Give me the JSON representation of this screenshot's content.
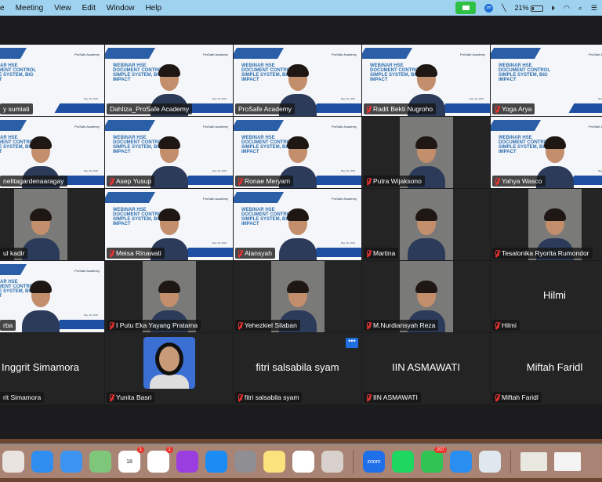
{
  "menubar": {
    "items": [
      "e",
      "Meeting",
      "View",
      "Edit",
      "Window",
      "Help"
    ],
    "battery": "21%",
    "battery_level": 0.21
  },
  "slide": {
    "brand": "ProSafe Academy",
    "title": "WEBINAR HSE DOCUMENT CONTROL SIMPLE SYSTEM, BIG IMPACT",
    "date": "May 18, 2025"
  },
  "tiles": [
    {
      "name": "y sumiati",
      "type": "slide",
      "muted": false
    },
    {
      "name": "Dahliza_ProSafe Academy",
      "type": "slide-person",
      "muted": false,
      "active": true
    },
    {
      "name": "ProSafe Academy",
      "type": "slide-person",
      "muted": false
    },
    {
      "name": "Radit Bekti Nugroho",
      "type": "slide-person",
      "muted": true
    },
    {
      "name": "Yoga Arya",
      "type": "slide",
      "muted": true
    },
    {
      "name": "nelitagardenaaragay",
      "type": "slide-person",
      "muted": false
    },
    {
      "name": "Asep Yusup",
      "type": "slide-person",
      "muted": true
    },
    {
      "name": "Ronae Meryam",
      "type": "slide-person",
      "muted": true
    },
    {
      "name": "Putra Wijaksono",
      "type": "narrow",
      "muted": true
    },
    {
      "name": "Yahya Wasco",
      "type": "slide-person",
      "muted": true
    },
    {
      "name": "ul kadir",
      "type": "narrow",
      "muted": false
    },
    {
      "name": "Meisa Rinawati",
      "type": "slide-person",
      "muted": true
    },
    {
      "name": "Alansyah",
      "type": "slide-person",
      "muted": true
    },
    {
      "name": "Martina",
      "type": "narrow",
      "muted": true
    },
    {
      "name": "Tesalonika Ryorita Rumondor",
      "type": "narrow",
      "muted": true
    },
    {
      "name": "rba",
      "type": "slide-person",
      "muted": false
    },
    {
      "name": "I Putu Eka Yayang Pratama",
      "type": "narrow",
      "muted": true
    },
    {
      "name": "Yehezkiel Silaban",
      "type": "narrow",
      "muted": true
    },
    {
      "name": "M.Nurdiansyah Reza",
      "type": "narrow",
      "muted": true
    },
    {
      "name": "Hilmi",
      "type": "noVideo",
      "display": "Hilmi",
      "muted": true
    },
    {
      "name": "rit Simamora",
      "type": "noVideo",
      "display": "Inggrit Simamora",
      "muted": false
    },
    {
      "name": "Yunita Basri",
      "type": "avatar",
      "muted": true
    },
    {
      "name": "fitri salsabila syam",
      "type": "noVideo",
      "display": "fitri salsabila syam",
      "muted": true
    },
    {
      "name": "IIN ASMAWATI",
      "type": "noVideo",
      "display": "IIN ASMAWATI",
      "muted": true
    },
    {
      "name": "Miftah Faridl",
      "type": "noVideo",
      "display": "Miftah Faridl",
      "muted": true
    }
  ],
  "more_button": "•••",
  "dock": [
    {
      "name": "launchpad",
      "color": "#e9e3e0"
    },
    {
      "name": "safari",
      "color": "#2f8ef0"
    },
    {
      "name": "mail",
      "color": "#3c94f0"
    },
    {
      "name": "maps",
      "color": "#7dc67a"
    },
    {
      "name": "calendar",
      "color": "#ffffff",
      "text": "18",
      "badge": "1"
    },
    {
      "name": "reminders",
      "color": "#ffffff",
      "badge": "1"
    },
    {
      "name": "podcasts",
      "color": "#9b3ee0"
    },
    {
      "name": "app-store",
      "color": "#1b8cf4"
    },
    {
      "name": "system-settings",
      "color": "#8e8e93"
    },
    {
      "name": "notes",
      "color": "#fbe27c"
    },
    {
      "name": "freeform",
      "color": "#ffffff"
    },
    {
      "name": "iphone-mirroring",
      "color": "#d8d0cc"
    },
    {
      "name": "zoom",
      "color": "#1f6fe8",
      "text": "zoom",
      "sep": true
    },
    {
      "name": "spotify",
      "color": "#1ed760"
    },
    {
      "name": "whatsapp",
      "color": "#2fc454",
      "badge": "207"
    },
    {
      "name": "keynote",
      "color": "#2a8df0"
    },
    {
      "name": "preview",
      "color": "#dfe8ef"
    },
    {
      "name": "chrome-window-1",
      "color": "#e8e8e0",
      "sep": true
    },
    {
      "name": "chrome-window-2",
      "color": "#f3f3f3"
    }
  ]
}
